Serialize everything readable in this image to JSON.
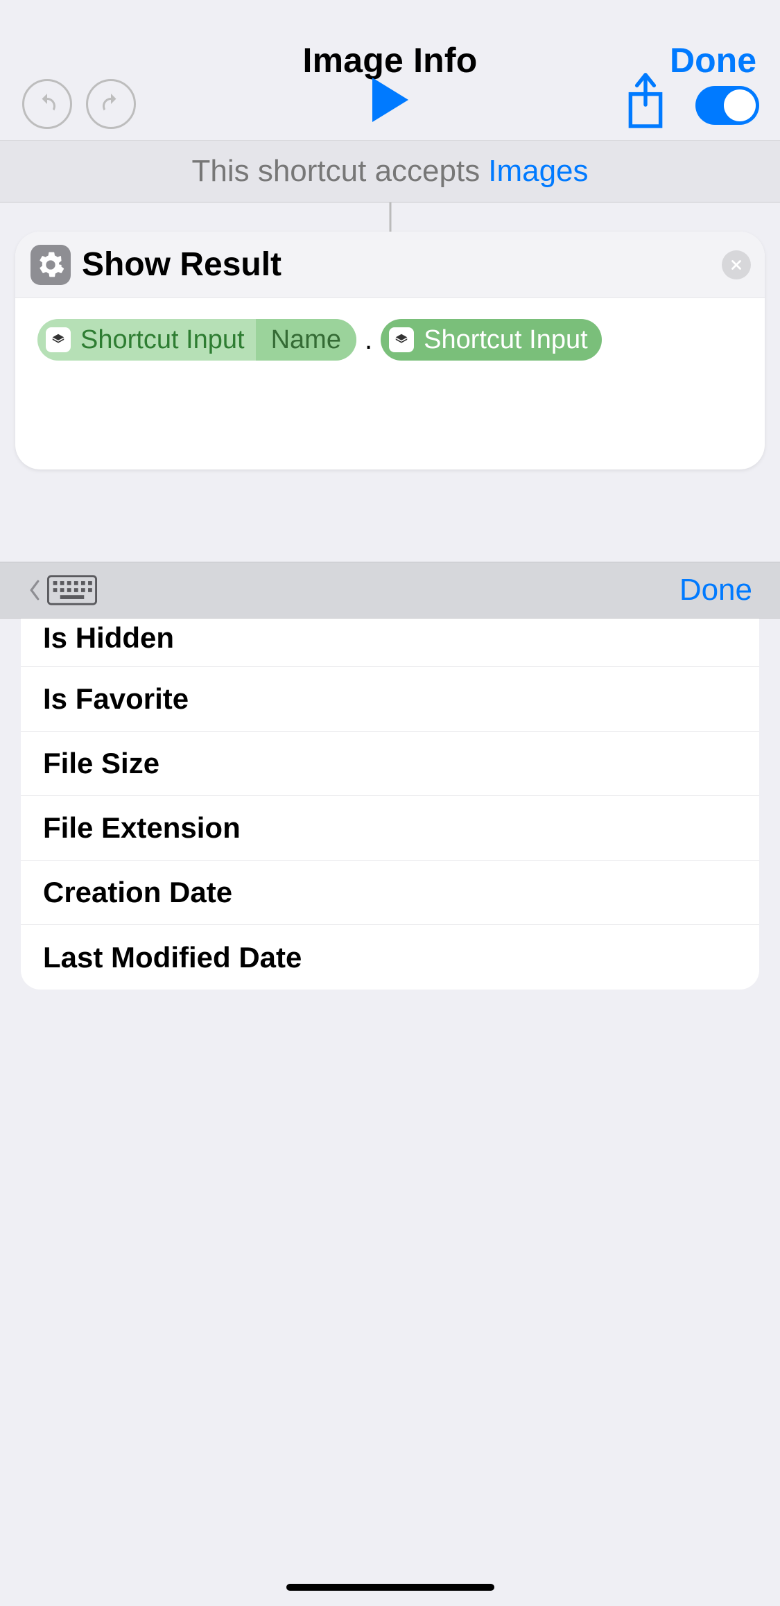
{
  "nav": {
    "title": "Image Info",
    "done": "Done"
  },
  "accepts": {
    "prefix": "This shortcut accepts",
    "type": "Images"
  },
  "action": {
    "title": "Show Result",
    "pill1_label": "Shortcut Input",
    "pill1_attr": "Name",
    "separator": ".",
    "pill2_label": "Shortcut Input"
  },
  "kb": {
    "done": "Done"
  },
  "options": [
    "Is Hidden",
    "Is Favorite",
    "File Size",
    "File Extension",
    "Creation Date",
    "Last Modified Date"
  ]
}
